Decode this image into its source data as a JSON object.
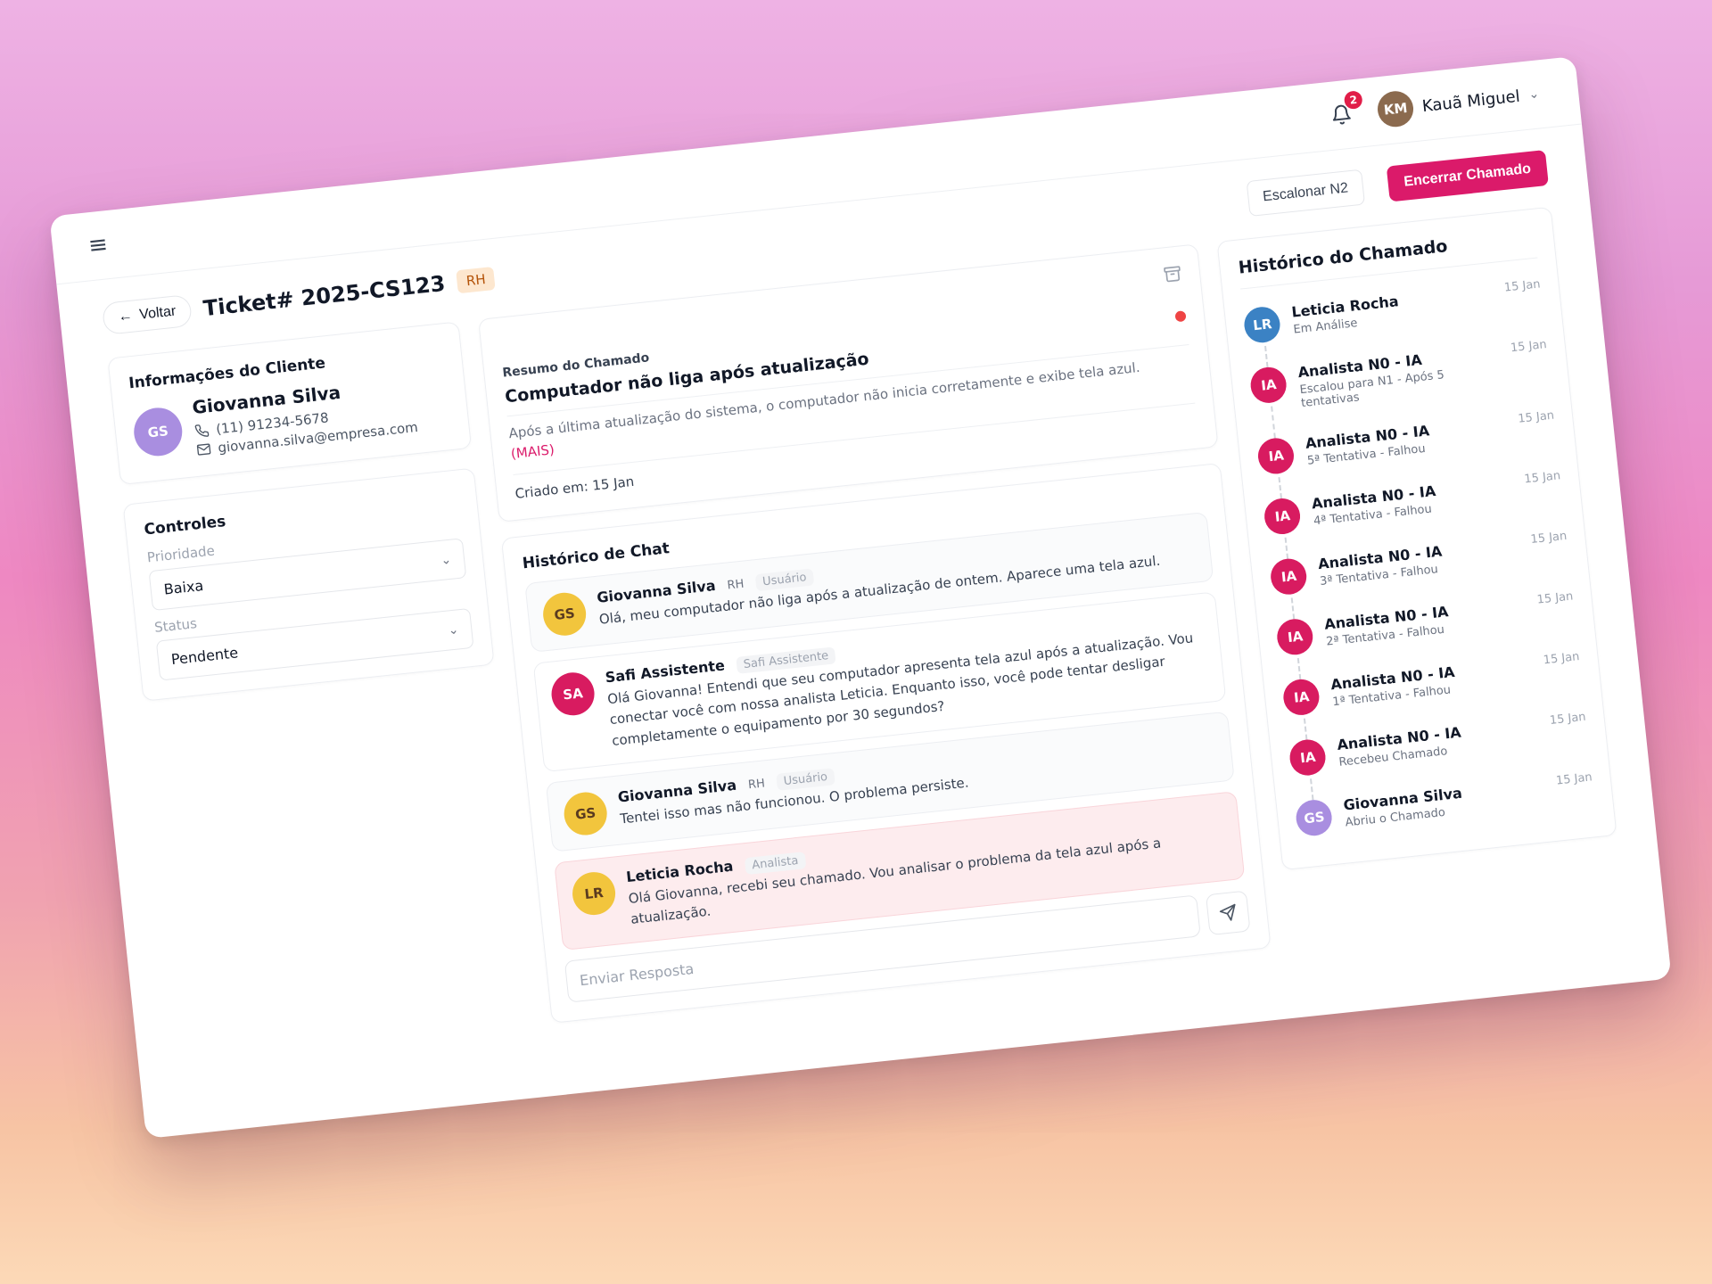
{
  "topbar": {
    "notifications_count": "2",
    "user_name": "Kauã Miguel"
  },
  "header": {
    "back_label": "Voltar",
    "ticket_title": "Ticket# 2025-CS123",
    "department": "RH",
    "escalate_label": "Escalonar N2",
    "close_label": "Encerrar Chamado"
  },
  "client": {
    "section_title": "Informações do Cliente",
    "name": "Giovanna Silva",
    "phone": "(11) 91234-5678",
    "email": "giovanna.silva@empresa.com"
  },
  "controls": {
    "section_title": "Controles",
    "priority_label": "Prioridade",
    "priority_value": "Baixa",
    "status_label": "Status",
    "status_value": "Pendente"
  },
  "summary": {
    "section_title": "Resumo do Chamado",
    "title": "Computador não liga após atualização",
    "description": "Após a última atualização do sistema, o computador não inicia corretamente e exibe tela azul.",
    "more_label": "(MAIS)",
    "created": "Criado em: 15 Jan"
  },
  "chat": {
    "section_title": "Histórico de Chat",
    "messages": [
      {
        "name": "Giovanna Silva",
        "dept": "RH",
        "role": "Usuário",
        "text": "Olá, meu computador não liga após a atualização de ontem. Aparece uma tela azul."
      },
      {
        "name": "Safi Assistente",
        "dept": "",
        "role": "Safi Assistente",
        "text": "Olá Giovanna! Entendi que seu computador apresenta tela azul após a atualização. Vou conectar você com nossa analista Leticia. Enquanto isso, você pode tentar desligar completamente o equipamento por 30 segundos?"
      },
      {
        "name": "Giovanna Silva",
        "dept": "RH",
        "role": "Usuário",
        "text": "Tentei isso mas não funcionou. O problema persiste."
      },
      {
        "name": "Leticia Rocha",
        "dept": "",
        "role": "Analista",
        "text": "Olá Giovanna, recebi seu chamado. Vou analisar o problema da tela azul após a atualização."
      }
    ],
    "reply_placeholder": "Enviar Resposta"
  },
  "history": {
    "section_title": "Histórico do Chamado",
    "items": [
      {
        "name": "Leticia Rocha",
        "sub": "Em Análise",
        "date": "15 Jan"
      },
      {
        "name": "Analista N0 - IA",
        "sub": "Escalou para N1 - Após 5 tentativas",
        "date": "15 Jan"
      },
      {
        "name": "Analista N0 - IA",
        "sub": "5ª Tentativa - Falhou",
        "date": "15 Jan"
      },
      {
        "name": "Analista N0 - IA",
        "sub": "4ª Tentativa - Falhou",
        "date": "15 Jan"
      },
      {
        "name": "Analista N0 - IA",
        "sub": "3ª Tentativa - Falhou",
        "date": "15 Jan"
      },
      {
        "name": "Analista N0 - IA",
        "sub": "2ª Tentativa - Falhou",
        "date": "15 Jan"
      },
      {
        "name": "Analista N0 - IA",
        "sub": "1ª Tentativa - Falhou",
        "date": "15 Jan"
      },
      {
        "name": "Analista N0 - IA",
        "sub": "Recebeu Chamado",
        "date": "15 Jan"
      },
      {
        "name": "Giovanna Silva",
        "sub": "Abriu o Chamado",
        "date": "15 Jan"
      }
    ]
  },
  "colors": {
    "primary": "#db1a6a",
    "badge_bg": "#fde7cf",
    "notification": "#e11d48",
    "status_dot": "#ef4444",
    "highlight_bg": "#fdecee"
  },
  "icons": {
    "menu": "hamburger-menu-icon",
    "bell": "bell-icon",
    "back": "arrow-left-icon",
    "phone": "phone-icon",
    "email": "mail-icon",
    "chevron": "chevron-down-icon",
    "archive": "archive-icon",
    "send": "send-icon"
  }
}
